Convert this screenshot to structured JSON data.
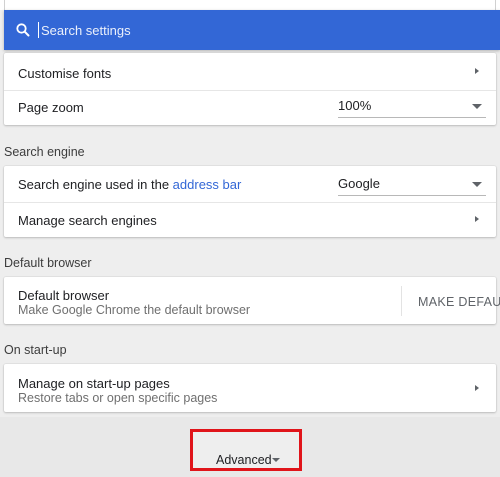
{
  "search": {
    "placeholder": "Search settings",
    "icon": "search-icon"
  },
  "appearance": {
    "customise_fonts_label": "Customise fonts",
    "page_zoom_label": "Page zoom",
    "page_zoom_value": "100%"
  },
  "search_engine": {
    "heading": "Search engine",
    "used_in_label_prefix": "Search engine used in the ",
    "used_in_label_link": "address bar",
    "engine_value": "Google",
    "manage_label": "Manage search engines"
  },
  "default_browser": {
    "heading": "Default browser",
    "title": "Default browser",
    "subtitle": "Make Google Chrome the default browser",
    "button_label": "MAKE DEFAULT"
  },
  "startup": {
    "heading": "On start-up",
    "title": "Manage on start-up pages",
    "subtitle": "Restore tabs or open specific pages"
  },
  "advanced": {
    "label": "Advanced"
  },
  "colors": {
    "search_bar": "#3367d6",
    "link": "#3367d6",
    "highlight_box": "#e0141a"
  }
}
